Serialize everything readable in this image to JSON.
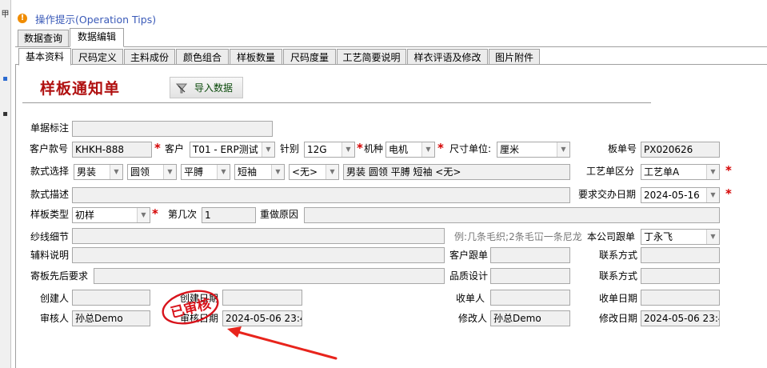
{
  "tip": {
    "text": "操作提示(Operation Tips)",
    "icon": "warning-icon",
    "color": "#f08c00"
  },
  "top_tabs": [
    "数据查询",
    "数据编辑"
  ],
  "sub_tabs": [
    "基本资料",
    "尺码定义",
    "主料成份",
    "颜色组合",
    "样板数量",
    "尺码度量",
    "工艺简要说明",
    "样衣评语及修改",
    "图片附件"
  ],
  "page_title": "样板通知单",
  "import_button": "导入数据",
  "stamp_text": "已审核",
  "labels": {
    "doc_mark": "单据标注",
    "customer_style_no": "客户款号",
    "customer": "客户",
    "needle": "针别",
    "machine": "机种",
    "size_unit": "尺寸单位:",
    "board_no": "板单号",
    "style_select": "款式选择",
    "process_type": "工艺单区分",
    "style_desc": "款式描述",
    "required_date": "要求交办日期",
    "sample_type": "样板类型",
    "times": "第几次",
    "redo_reason": "重做原因",
    "yarn_detail": "纱线细节",
    "yarn_hint": "例:几条毛织;2条毛冚一条尼龙",
    "company_merch": "本公司跟单",
    "accessory": "辅料说明",
    "customer_merch": "客户跟单",
    "contact1": "联系方式",
    "send_req": "寄板先后要求",
    "quality_design": "品质设计",
    "contact2": "联系方式",
    "creator": "创建人",
    "create_date": "创建日期",
    "receiver": "收单人",
    "receive_date": "收单日期",
    "auditor": "审核人",
    "audit_date": "审核日期",
    "modifier": "修改人",
    "modify_date": "修改日期"
  },
  "values": {
    "doc_mark": "",
    "customer_style_no": "KHKH-888",
    "customer": "T01 - ERP测试",
    "needle": "12G",
    "machine": "电机",
    "size_unit": "厘米",
    "board_no": "PX020626",
    "style_gender": "男装",
    "style_collar": "圆领",
    "style_shoulder": "平膊",
    "style_sleeve": "短袖",
    "style_other": "<无>",
    "style_combined": "男装 圆领 平膊 短袖 <无>",
    "process_type": "工艺单A",
    "style_desc": "",
    "required_date": "2024-05-16",
    "sample_type": "初样",
    "times": "1",
    "redo_reason": "",
    "yarn_detail": "",
    "company_merch": "丁永飞",
    "accessory": "",
    "customer_merch": "",
    "contact1": "",
    "send_req": "",
    "quality_design": "",
    "contact2": "",
    "creator": "",
    "create_date": "",
    "receiver": "",
    "receive_date": "",
    "auditor": "孙总Demo",
    "audit_date": "2024-05-06 23:4",
    "modifier": "孙总Demo",
    "modify_date": "2024-05-06 23:4"
  },
  "colors": {
    "title": "#b01010",
    "required_star": "#d40000",
    "tip_text": "#3a5ab8",
    "stamp": "#d8141c",
    "arrow": "#e8241c"
  }
}
